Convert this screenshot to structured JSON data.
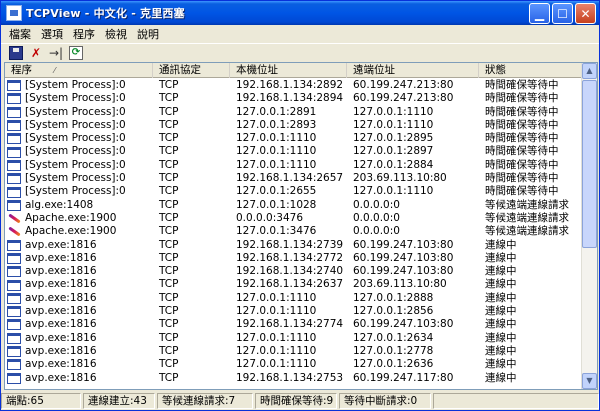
{
  "window": {
    "title": "TCPView - 中文化 - 克里西塞"
  },
  "menu": [
    "檔案",
    "選項",
    "程序",
    "檢視",
    "說明"
  ],
  "columns": [
    "程序",
    "通訊協定",
    "本機位址",
    "遠端位址",
    "狀態"
  ],
  "rows": [
    {
      "icon": "window",
      "process": "[System Process]:0",
      "protocol": "TCP",
      "local": "192.168.1.134:2892",
      "remote": "60.199.247.213:80",
      "state": "時間確保等待中"
    },
    {
      "icon": "window",
      "process": "[System Process]:0",
      "protocol": "TCP",
      "local": "192.168.1.134:2894",
      "remote": "60.199.247.213:80",
      "state": "時間確保等待中"
    },
    {
      "icon": "window",
      "process": "[System Process]:0",
      "protocol": "TCP",
      "local": "127.0.0.1:2891",
      "remote": "127.0.0.1:1110",
      "state": "時間確保等待中"
    },
    {
      "icon": "window",
      "process": "[System Process]:0",
      "protocol": "TCP",
      "local": "127.0.0.1:2893",
      "remote": "127.0.0.1:1110",
      "state": "時間確保等待中"
    },
    {
      "icon": "window",
      "process": "[System Process]:0",
      "protocol": "TCP",
      "local": "127.0.0.1:1110",
      "remote": "127.0.0.1:2895",
      "state": "時間確保等待中"
    },
    {
      "icon": "window",
      "process": "[System Process]:0",
      "protocol": "TCP",
      "local": "127.0.0.1:1110",
      "remote": "127.0.0.1:2897",
      "state": "時間確保等待中"
    },
    {
      "icon": "window",
      "process": "[System Process]:0",
      "protocol": "TCP",
      "local": "127.0.0.1:1110",
      "remote": "127.0.0.1:2884",
      "state": "時間確保等待中"
    },
    {
      "icon": "window",
      "process": "[System Process]:0",
      "protocol": "TCP",
      "local": "192.168.1.134:2657",
      "remote": "203.69.113.10:80",
      "state": "時間確保等待中"
    },
    {
      "icon": "window",
      "process": "[System Process]:0",
      "protocol": "TCP",
      "local": "127.0.0.1:2655",
      "remote": "127.0.0.1:1110",
      "state": "時間確保等待中"
    },
    {
      "icon": "window",
      "process": "alg.exe:1408",
      "protocol": "TCP",
      "local": "127.0.0.1:1028",
      "remote": "0.0.0.0:0",
      "state": "等候遠端連線請求"
    },
    {
      "icon": "feather",
      "process": "Apache.exe:1900",
      "protocol": "TCP",
      "local": "0.0.0.0:3476",
      "remote": "0.0.0.0:0",
      "state": "等候遠端連線請求"
    },
    {
      "icon": "feather",
      "process": "Apache.exe:1900",
      "protocol": "TCP",
      "local": "127.0.0.1:3476",
      "remote": "0.0.0.0:0",
      "state": "等候遠端連線請求"
    },
    {
      "icon": "window",
      "process": "avp.exe:1816",
      "protocol": "TCP",
      "local": "192.168.1.134:2739",
      "remote": "60.199.247.103:80",
      "state": "連線中"
    },
    {
      "icon": "window",
      "process": "avp.exe:1816",
      "protocol": "TCP",
      "local": "192.168.1.134:2772",
      "remote": "60.199.247.103:80",
      "state": "連線中"
    },
    {
      "icon": "window",
      "process": "avp.exe:1816",
      "protocol": "TCP",
      "local": "192.168.1.134:2740",
      "remote": "60.199.247.103:80",
      "state": "連線中"
    },
    {
      "icon": "window",
      "process": "avp.exe:1816",
      "protocol": "TCP",
      "local": "192.168.1.134:2637",
      "remote": "203.69.113.10:80",
      "state": "連線中"
    },
    {
      "icon": "window",
      "process": "avp.exe:1816",
      "protocol": "TCP",
      "local": "127.0.0.1:1110",
      "remote": "127.0.0.1:2888",
      "state": "連線中"
    },
    {
      "icon": "window",
      "process": "avp.exe:1816",
      "protocol": "TCP",
      "local": "127.0.0.1:1110",
      "remote": "127.0.0.1:2856",
      "state": "連線中"
    },
    {
      "icon": "window",
      "process": "avp.exe:1816",
      "protocol": "TCP",
      "local": "192.168.1.134:2774",
      "remote": "60.199.247.103:80",
      "state": "連線中"
    },
    {
      "icon": "window",
      "process": "avp.exe:1816",
      "protocol": "TCP",
      "local": "127.0.0.1:1110",
      "remote": "127.0.0.1:2634",
      "state": "連線中"
    },
    {
      "icon": "window",
      "process": "avp.exe:1816",
      "protocol": "TCP",
      "local": "127.0.0.1:1110",
      "remote": "127.0.0.1:2778",
      "state": "連線中"
    },
    {
      "icon": "window",
      "process": "avp.exe:1816",
      "protocol": "TCP",
      "local": "127.0.0.1:1110",
      "remote": "127.0.0.1:2636",
      "state": "連線中"
    },
    {
      "icon": "window",
      "process": "avp.exe:1816",
      "protocol": "TCP",
      "local": "192.168.1.134:2753",
      "remote": "60.199.247.117:80",
      "state": "連線中"
    }
  ],
  "status": [
    "端點:65",
    "連線建立:43",
    "等候連線請求:7",
    "時間確保等待:9",
    "等待中斷請求:0",
    ""
  ],
  "colors": {
    "titlebar": "#0055e5",
    "close_button": "#c6401e",
    "list_border": "#7f9db9"
  }
}
